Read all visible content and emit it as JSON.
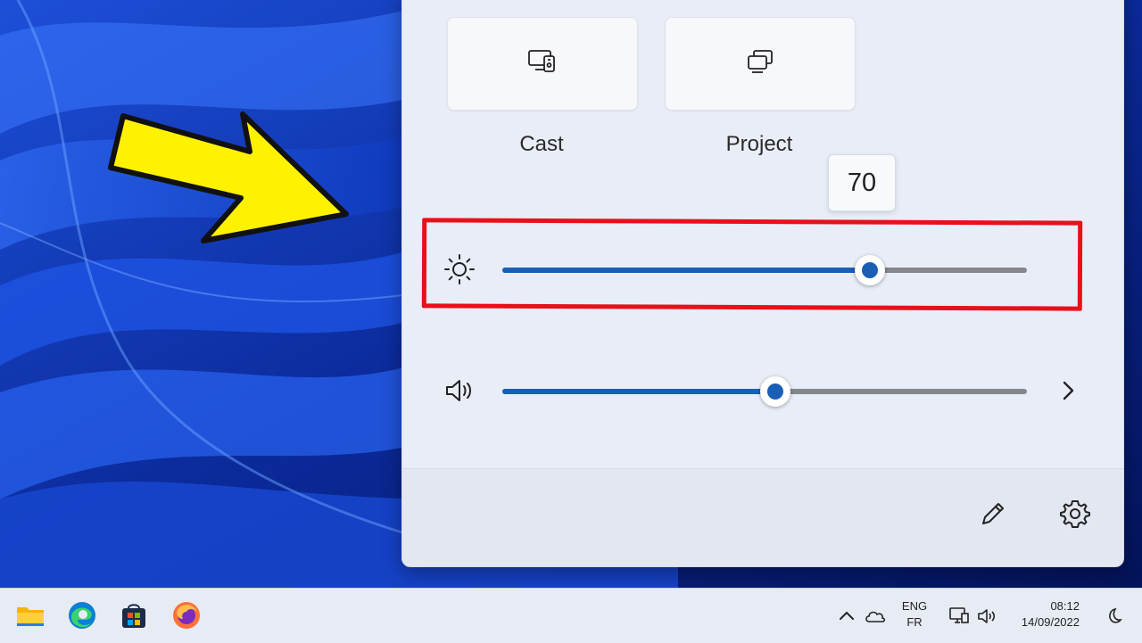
{
  "quick_settings": {
    "tiles": [
      {
        "label": "Cast",
        "icon": "cast-icon"
      },
      {
        "label": "Project",
        "icon": "project-icon"
      }
    ],
    "brightness": {
      "icon": "brightness-icon",
      "value": 70,
      "tooltip": "70"
    },
    "volume": {
      "icon": "speaker-icon",
      "value": 52
    },
    "footer": {
      "edit_icon": "pencil-icon",
      "settings_icon": "gear-icon"
    }
  },
  "annotation": {
    "arrow_color": "#fff200",
    "box_color": "#e8101a"
  },
  "taskbar": {
    "apps": [
      "file-explorer-icon",
      "edge-icon",
      "microsoft-store-icon",
      "firefox-icon"
    ],
    "tray": {
      "language_line1": "ENG",
      "language_line2": "FR",
      "time": "08:12",
      "date": "14/09/2022"
    }
  },
  "colors": {
    "accent": "#1a5fb4",
    "panel_bg": "#e9edf7",
    "track": "#85878d"
  }
}
